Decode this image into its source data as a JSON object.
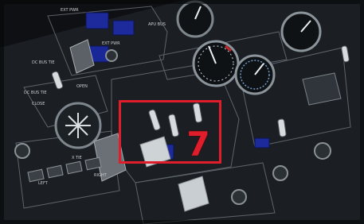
{
  "overlay": {
    "callout_number": "7",
    "callout_color": "#e01e2b"
  },
  "panel": {
    "labels": {
      "ext_pwr_left": "EXT PWR",
      "ext_pwr_right": "EXT PWR",
      "apu_bus": "APU BUS",
      "dc_bus_tie_top": "DC BUS TIE",
      "dc_bus_tie_bottom": "DC BUS TIE",
      "open": "OPEN",
      "close": "CLOSE",
      "left": "LEFT",
      "right": "RIGHT",
      "xtie": "X TIE"
    },
    "colors": {
      "annunciator_blue": "#1c2a9c",
      "panel_grey": "#2b3035"
    }
  }
}
